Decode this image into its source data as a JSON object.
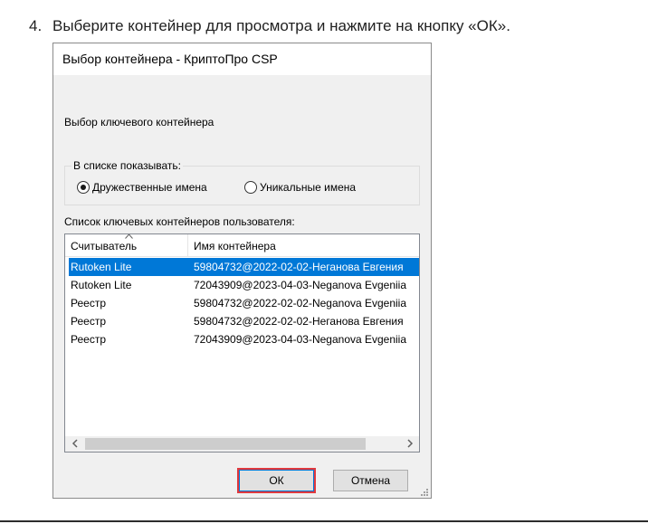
{
  "instruction": {
    "number": "4.",
    "text": "Выберите контейнер для просмотра и нажмите на кнопку «ОК»."
  },
  "dialog": {
    "title": "Выбор контейнера - КриптоПро CSP",
    "section_label": "Выбор ключевого контейнера",
    "show_group": {
      "legend": "В списке показывать:",
      "options": [
        {
          "label": "Дружественные имена",
          "selected": true
        },
        {
          "label": "Уникальные имена",
          "selected": false
        }
      ]
    },
    "list_label": "Список ключевых контейнеров пользователя:",
    "list": {
      "columns": [
        "Считыватель",
        "Имя контейнера"
      ],
      "sorted_column": "Считыватель",
      "rows": [
        {
          "reader": "Rutoken Lite",
          "container": "59804732@2022-02-02-Неганова Евгения",
          "selected": true
        },
        {
          "reader": "Rutoken Lite",
          "container": "72043909@2023-04-03-Neganova Evgeniia",
          "selected": false
        },
        {
          "reader": "Реестр",
          "container": "59804732@2022-02-02-Neganova Evgeniia",
          "selected": false
        },
        {
          "reader": "Реестр",
          "container": "59804732@2022-02-02-Неганова Евгения",
          "selected": false
        },
        {
          "reader": "Реестр",
          "container": "72043909@2023-04-03-Neganova Evgeniia",
          "selected": false
        }
      ]
    },
    "buttons": {
      "ok": "ОК",
      "cancel": "Отмена"
    }
  },
  "colors": {
    "selection": "#0078d7",
    "highlight_box": "#e0393e",
    "dialog_bg": "#f0f0f0"
  },
  "icons": {
    "radio_selected": "radio-checked-icon",
    "radio_unselected": "radio-unchecked-icon",
    "sort": "sort-ascending-icon",
    "scroll_left": "chevron-left-icon",
    "scroll_right": "chevron-right-icon",
    "resize": "resize-grip-icon"
  }
}
